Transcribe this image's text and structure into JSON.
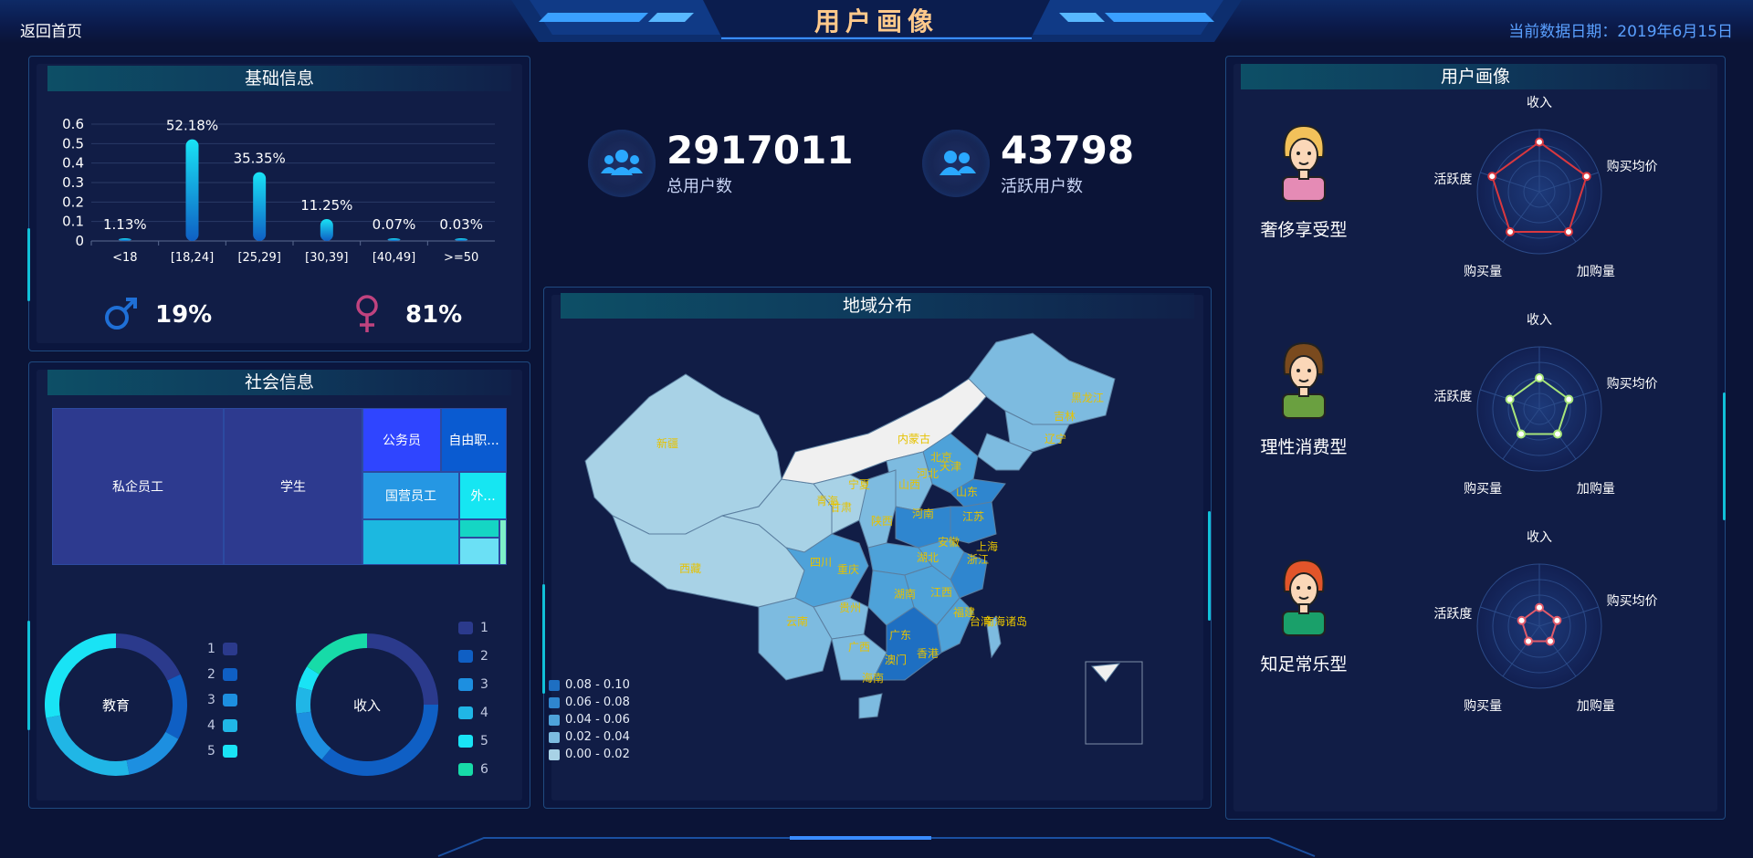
{
  "header": {
    "back_label": "返回首页",
    "title": "用户画像",
    "date_text": "当前数据日期：2019年6月15日"
  },
  "basic_panel": {
    "title": "基础信息",
    "gender": [
      {
        "symbol": "♂",
        "value": "19%",
        "icon": "male-icon",
        "color": "#1f6fd6"
      },
      {
        "symbol": "♀",
        "value": "81%",
        "icon": "female-icon",
        "color": "#c0437f"
      }
    ]
  },
  "social_panel": {
    "title": "社会信息",
    "treemap": [
      {
        "label": "私企员工",
        "color": "#2d3a8f"
      },
      {
        "label": "学生",
        "color": "#2d3a8f"
      },
      {
        "label": "公务员",
        "color": "#2f45ff"
      },
      {
        "label": "自由职...",
        "color": "#0a5bd1"
      },
      {
        "label": "国营员工",
        "color": "#2597e3"
      },
      {
        "label": "外...",
        "color": "#16e6f2"
      },
      {
        "label": "",
        "color": "#1cb8e0"
      },
      {
        "label": "",
        "color": "#15d6c4"
      },
      {
        "label": "",
        "color": "#6be0f5"
      },
      {
        "label": "",
        "color": "#7ef0c8"
      }
    ],
    "donut_education": {
      "center": "教育",
      "legend": [
        "1",
        "2",
        "3",
        "4",
        "5"
      ],
      "colors": [
        "#2b3a8c",
        "#0f5fc4",
        "#1d8fe0",
        "#20b6e6",
        "#19e3f5"
      ]
    },
    "donut_income": {
      "center": "收入",
      "legend": [
        "1",
        "2",
        "3",
        "4",
        "5",
        "6"
      ],
      "colors": [
        "#2b3a8c",
        "#0f5fc4",
        "#1d8fe0",
        "#20b6e6",
        "#19e3f5",
        "#17dba8"
      ]
    }
  },
  "kpi": [
    {
      "value": "2917011",
      "label": "总用户数",
      "icon": "users-group-icon"
    },
    {
      "value": "43798",
      "label": "活跃用户数",
      "icon": "active-users-icon"
    }
  ],
  "map_panel": {
    "title": "地域分布",
    "legend": [
      {
        "label": "0.08 - 0.10",
        "color": "#1e6fc2"
      },
      {
        "label": "0.06 - 0.08",
        "color": "#2f86cf"
      },
      {
        "label": "0.04 - 0.06",
        "color": "#4ea2d9"
      },
      {
        "label": "0.02 - 0.04",
        "color": "#7dbbe0"
      },
      {
        "label": "0.00 - 0.02",
        "color": "#a8d2e6"
      }
    ],
    "labels": [
      "新疆",
      "西藏",
      "内蒙古",
      "黑龙江",
      "吉林",
      "辽宁",
      "北京",
      "天津",
      "河北",
      "山西",
      "山东",
      "宁夏",
      "青海",
      "甘肃",
      "陕西",
      "河南",
      "江苏",
      "安徽",
      "上海",
      "浙江",
      "湖北",
      "四川",
      "重庆",
      "湖南",
      "江西",
      "福建",
      "贵州",
      "云南",
      "广西",
      "广东",
      "香港",
      "澳门",
      "海南",
      "台湾",
      "南海诸岛"
    ]
  },
  "persona_panel": {
    "title": "用户画像",
    "radar_axes": [
      "收入",
      "购买均价",
      "加购量",
      "购买量",
      "活跃度"
    ],
    "personas": [
      {
        "name": "奢侈享受型",
        "icon": "woman-avatar-icon",
        "color": "#d9383f",
        "values": [
          0.8,
          0.8,
          0.8,
          0.8,
          0.8
        ]
      },
      {
        "name": "理性消费型",
        "icon": "man-avatar-icon",
        "color": "#a7e57a",
        "values": [
          0.5,
          0.5,
          0.5,
          0.5,
          0.5
        ]
      },
      {
        "name": "知足常乐型",
        "icon": "girl-avatar-icon",
        "color": "#e05a6a",
        "values": [
          0.3,
          0.3,
          0.3,
          0.3,
          0.3
        ]
      }
    ]
  },
  "chart_data": [
    {
      "type": "bar",
      "title": "基础信息",
      "categories": [
        "<18",
        "[18,24]",
        "[25,29]",
        "[30,39]",
        "[40,49]",
        ">=50"
      ],
      "values": [
        0.0113,
        0.5218,
        0.3535,
        0.1125,
        0.0007,
        0.0003
      ],
      "data_labels": [
        "1.13%",
        "52.18%",
        "35.35%",
        "11.25%",
        "0.07%",
        "0.03%"
      ],
      "yticks": [
        "0",
        "0.1",
        "0.2",
        "0.3",
        "0.4",
        "0.5",
        "0.6"
      ],
      "ylim": [
        0,
        0.6
      ],
      "grid": true
    },
    {
      "type": "pie",
      "title": "教育",
      "categories": [
        "1",
        "2",
        "3",
        "4",
        "5"
      ],
      "values": [
        18,
        15,
        14,
        25,
        28
      ]
    },
    {
      "type": "pie",
      "title": "收入",
      "categories": [
        "1",
        "2",
        "3",
        "4",
        "5",
        "6"
      ],
      "values": [
        25,
        36,
        12,
        6,
        5,
        16
      ]
    }
  ]
}
